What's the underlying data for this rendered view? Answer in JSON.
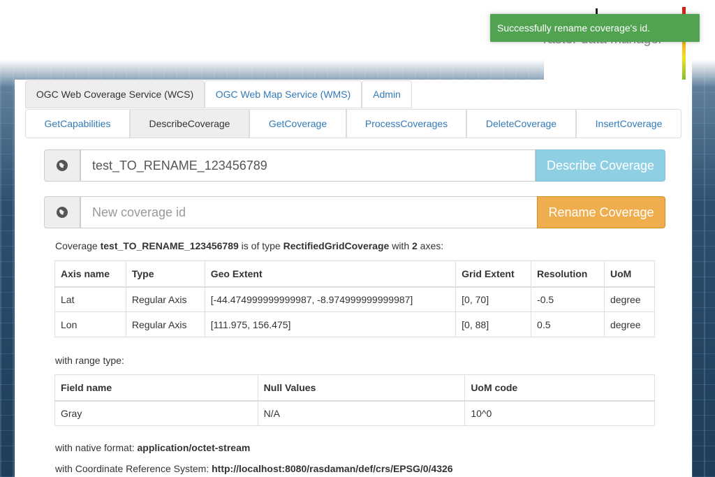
{
  "logo": {
    "tagline": "raster data manager"
  },
  "toast": {
    "message": "Successfully rename coverage's id."
  },
  "main_tabs": [
    {
      "label": "OGC Web Coverage Service (WCS)",
      "active": true
    },
    {
      "label": "OGC Web Map Service (WMS)",
      "active": false
    },
    {
      "label": "Admin",
      "active": false
    }
  ],
  "sub_tabs": [
    {
      "label": "GetCapabilities",
      "active": false
    },
    {
      "label": "DescribeCoverage",
      "active": true
    },
    {
      "label": "GetCoverage",
      "active": false
    },
    {
      "label": "ProcessCoverages",
      "active": false
    },
    {
      "label": "DeleteCoverage",
      "active": false
    },
    {
      "label": "InsertCoverage",
      "active": false
    }
  ],
  "describe": {
    "icon": "globe-icon",
    "value": "test_TO_RENAME_123456789",
    "button": "Describe Coverage"
  },
  "rename": {
    "icon": "globe-icon",
    "placeholder": "New coverage id",
    "button": "Rename Coverage"
  },
  "summary": {
    "prefix": "Coverage ",
    "coverage_id": "test_TO_RENAME_123456789",
    "mid": " is of type ",
    "type": "RectifiedGridCoverage",
    "with": " with ",
    "axes_count": "2",
    "suffix": " axes:"
  },
  "axes_table": {
    "headers": [
      "Axis name",
      "Type",
      "Geo Extent",
      "Grid Extent",
      "Resolution",
      "UoM"
    ],
    "rows": [
      [
        "Lat",
        "Regular Axis",
        "[-44.474999999999987, -8.974999999999987]",
        "[0, 70]",
        "-0.5",
        "degree"
      ],
      [
        "Lon",
        "Regular Axis",
        "[111.975, 156.475]",
        "[0, 88]",
        "0.5",
        "degree"
      ]
    ]
  },
  "range_label": "with range type:",
  "range_table": {
    "headers": [
      "Field name",
      "Null Values",
      "UoM code"
    ],
    "rows": [
      [
        "Gray",
        "N/A",
        "10^0"
      ]
    ]
  },
  "native_format": {
    "label": "with native format: ",
    "value": "application/octet-stream"
  },
  "crs": {
    "label": "with Coordinate Reference System: ",
    "value": "http://localhost:8080/rasdaman/def/crs/EPSG/0/4326"
  },
  "colors": {
    "info": "#8fcfe4",
    "warning": "#f0ad4e",
    "toast": "#51a351",
    "link": "#337ab7"
  }
}
